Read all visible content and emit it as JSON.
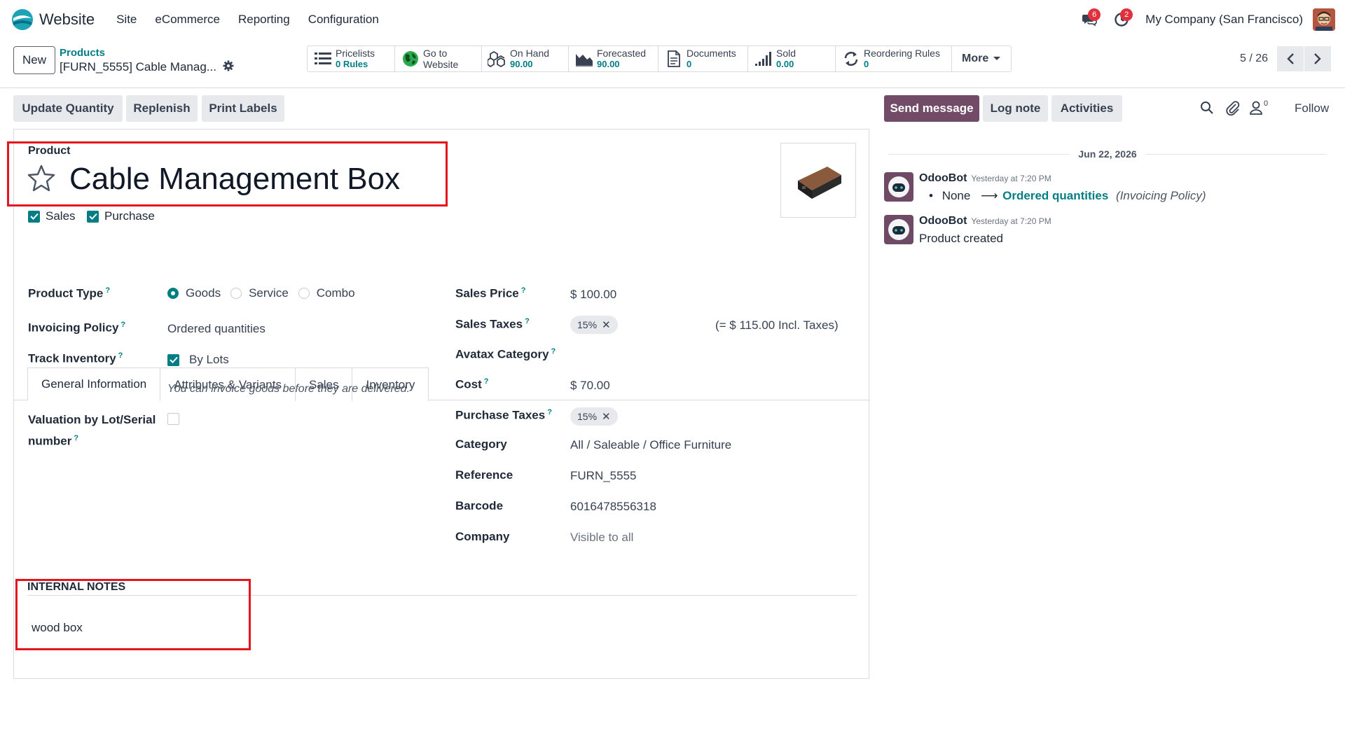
{
  "navbar": {
    "app_name": "Website",
    "menu": [
      "Site",
      "eCommerce",
      "Reporting",
      "Configuration"
    ],
    "messages_count": "6",
    "activities_count": "2",
    "company": "My Company (San Francisco)"
  },
  "control_panel": {
    "new_label": "New",
    "breadcrumb_parent": "Products",
    "breadcrumb_current": "[FURN_5555] Cable Manag...",
    "stats": [
      {
        "icon": "list-icon",
        "label": "Pricelists",
        "value": "0 Rules"
      },
      {
        "icon": "globe-icon",
        "label": "Go to",
        "value": "Website"
      },
      {
        "icon": "cubes-icon",
        "label": "On Hand",
        "value": "90.00"
      },
      {
        "icon": "area-chart-icon",
        "label": "Forecasted",
        "value": "90.00"
      },
      {
        "icon": "file-icon",
        "label": "Documents",
        "value": "0"
      },
      {
        "icon": "signal-icon",
        "label": "Sold",
        "value": "0.00"
      },
      {
        "icon": "refresh-icon",
        "label": "Reordering Rules",
        "value": "0"
      }
    ],
    "more_label": "More",
    "pager": "5 / 26"
  },
  "actions": {
    "update_quantity": "Update Quantity",
    "replenish": "Replenish",
    "print_labels": "Print Labels",
    "send_message": "Send message",
    "log_note": "Log note",
    "activities": "Activities",
    "followers_count": "0",
    "follow": "Follow"
  },
  "form": {
    "product_caption": "Product",
    "product_name": "Cable Management Box",
    "sales_label": "Sales",
    "purchase_label": "Purchase",
    "tabs": [
      "General Information",
      "Attributes & Variants",
      "Sales",
      "Inventory"
    ],
    "left": {
      "product_type_label": "Product Type",
      "product_type_options": [
        "Goods",
        "Service",
        "Combo"
      ],
      "product_type_selected": "Goods",
      "invoicing_policy_label": "Invoicing Policy",
      "invoicing_policy_value": "Ordered quantities",
      "track_inventory_label": "Track Inventory",
      "track_inventory_value": "By Lots",
      "invoice_hint": "You can invoice goods before they are delivered.",
      "valuation_label_1": "Valuation by Lot/Serial",
      "valuation_label_2": "number"
    },
    "right": {
      "sales_price_label": "Sales Price",
      "sales_price_value": "$ 100.00",
      "sales_taxes_label": "Sales Taxes",
      "sales_taxes_tag": "15%",
      "sales_taxes_incl": "(= $ 115.00 Incl. Taxes)",
      "avatax_label": "Avatax Category",
      "cost_label": "Cost",
      "cost_value": "$ 70.00",
      "purchase_taxes_label": "Purchase Taxes",
      "purchase_taxes_tag": "15%",
      "category_label": "Category",
      "category_value": "All / Saleable / Office Furniture",
      "reference_label": "Reference",
      "reference_value": "FURN_5555",
      "barcode_label": "Barcode",
      "barcode_value": "6016478556318",
      "company_label": "Company",
      "company_placeholder": "Visible to all"
    },
    "notes_heading": "INTERNAL NOTES",
    "notes_text": "wood box"
  },
  "chatter": {
    "date": "Jun 22, 2026",
    "messages": [
      {
        "author": "OdooBot",
        "time": "Yesterday at 7:20 PM",
        "old_value": "None",
        "new_value": "Ordered quantities",
        "field": "(Invoicing Policy)"
      },
      {
        "author": "OdooBot",
        "time": "Yesterday at 7:20 PM",
        "body": "Product created"
      }
    ]
  },
  "colors": {
    "accent": "#017e84",
    "brand_purple": "#714b67",
    "highlight_red": "#e4151f",
    "badge_red": "#e0313f"
  }
}
